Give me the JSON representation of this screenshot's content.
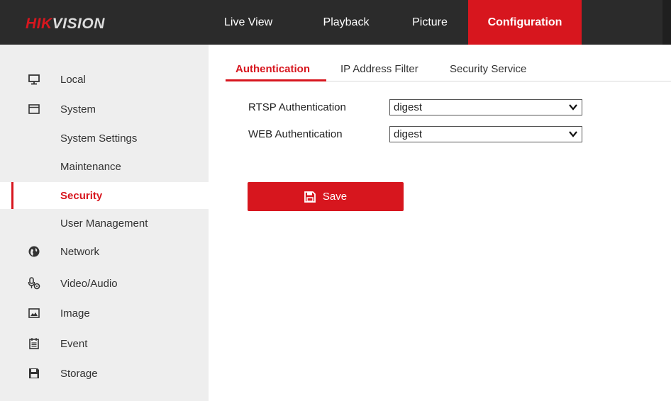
{
  "brand": {
    "part1": "HIK",
    "part2": "VISION"
  },
  "topnav": {
    "live_view": "Live View",
    "playback": "Playback",
    "picture": "Picture",
    "configuration": "Configuration"
  },
  "sidebar": {
    "local": "Local",
    "system": "System",
    "system_settings": "System Settings",
    "maintenance": "Maintenance",
    "security": "Security",
    "user_management": "User Management",
    "network": "Network",
    "video_audio": "Video/Audio",
    "image": "Image",
    "event": "Event",
    "storage": "Storage"
  },
  "tabs": {
    "authentication": "Authentication",
    "ip_address_filter": "IP Address Filter",
    "security_service": "Security Service"
  },
  "form": {
    "rtsp_label": "RTSP Authentication",
    "rtsp_value": "digest",
    "web_label": "WEB Authentication",
    "web_value": "digest"
  },
  "save_label": "Save",
  "colors": {
    "accent": "#d7161e",
    "topbar": "#2b2b2b",
    "sidebar": "#eeeeee"
  },
  "icons": [
    "monitor-icon",
    "system-icon",
    "network-icon",
    "video-audio-icon",
    "image-icon",
    "event-icon",
    "storage-icon",
    "save-icon",
    "chevron-down-icon"
  ]
}
